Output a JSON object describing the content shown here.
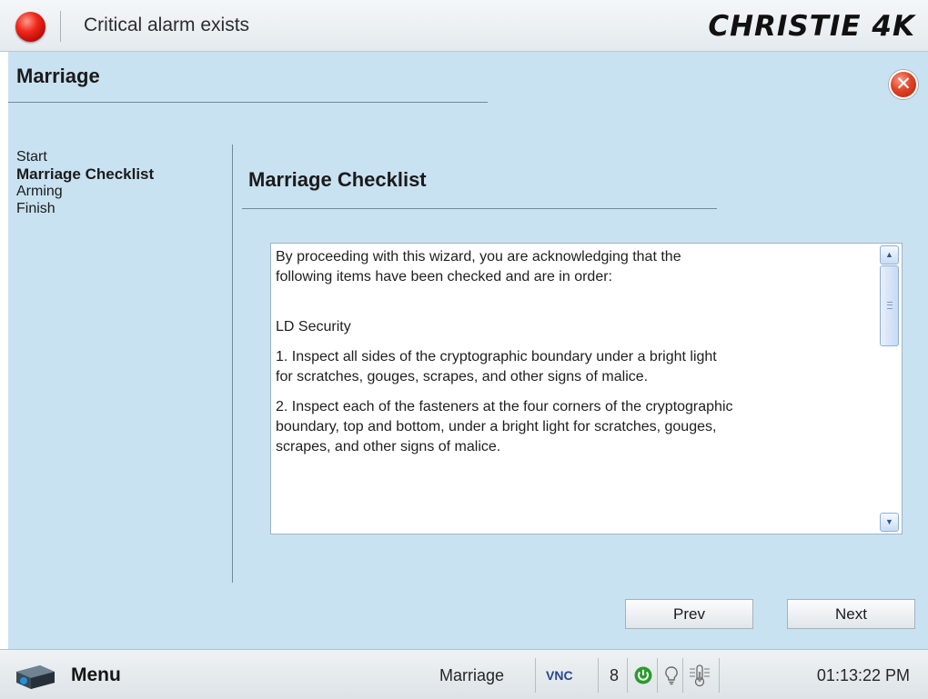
{
  "alarm": {
    "message": "Critical alarm exists",
    "led_color": "#e0241a"
  },
  "brand": {
    "logo_text": "CHRISTIE 4K"
  },
  "wizard": {
    "title": "Marriage",
    "close_icon": "close-icon",
    "steps": [
      "Start",
      "Marriage Checklist",
      "Arming",
      "Finish"
    ],
    "active_step": "Marriage Checklist",
    "page_title": "Marriage Checklist",
    "checklist": [
      "By proceeding with this wizard, you are acknowledging that the\nfollowing items have been checked and are in order:",
      "LD Security",
      "1. Inspect all sides of the cryptographic boundary under a bright light\nfor scratches, gouges, scrapes, and other signs of malice.",
      "2. Inspect each of the fasteners at the four corners of the cryptographic\nboundary, top and bottom, under a bright light for scratches, gouges,\nscrapes, and other signs of malice."
    ],
    "scroll_up_icon": "scroll-up-arrow-icon",
    "scroll_down_icon": "scroll-down-arrow-icon",
    "prev_label": "Prev",
    "next_label": "Next"
  },
  "statusbar": {
    "menu_label": "Menu",
    "menu_icon": "projector-icon",
    "mode": "Marriage",
    "vnc": "VNC",
    "count": "8",
    "power_icon": "power-icon",
    "power_color": "#2e9a2e",
    "lamp_icon": "lightbulb-icon",
    "temperature_icon": "thermometer-icon",
    "time": "01:13:22 PM"
  },
  "colors": {
    "panel_bg": "#c9e2f2",
    "rule": "#6e8b9d",
    "brand": "#111111"
  }
}
